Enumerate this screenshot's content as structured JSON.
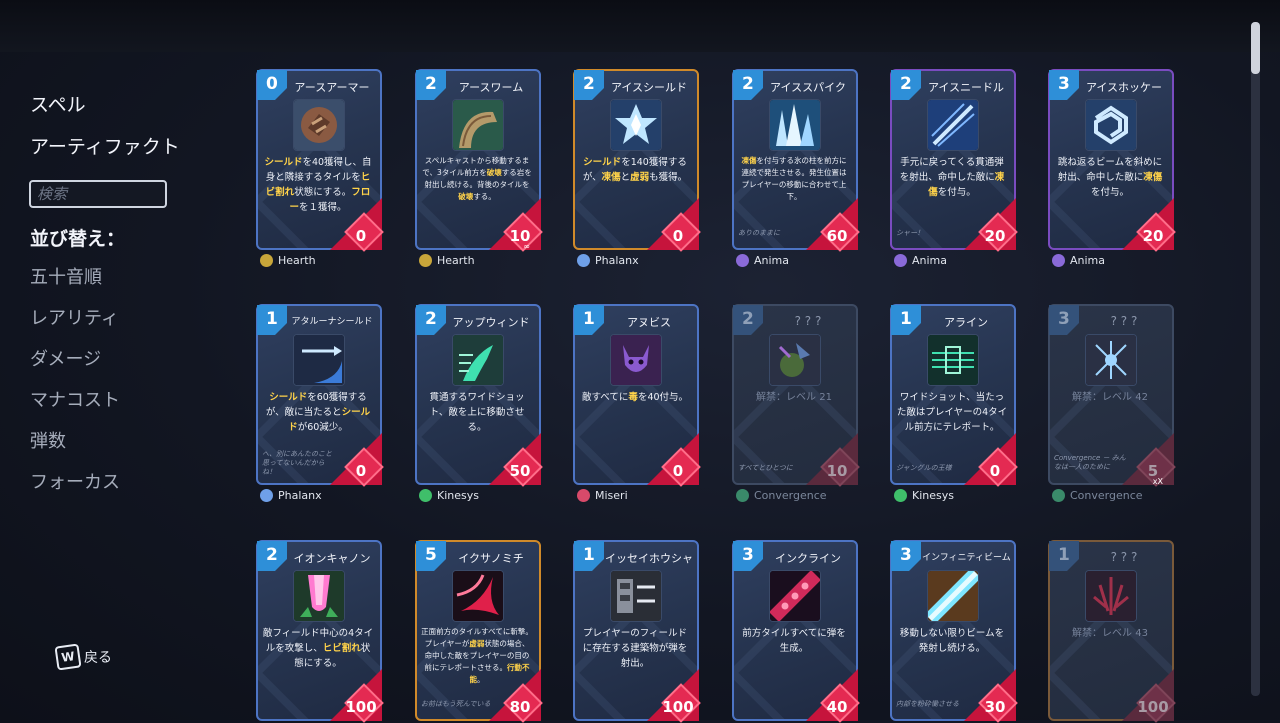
{
  "sidebar": {
    "spells": "スペル",
    "artifacts": "アーティファクト",
    "search_placeholder": "検索",
    "sort_label": "並び替え：",
    "sort_options": [
      "五十音順",
      "レアリティ",
      "ダメージ",
      "マナコスト",
      "弾数",
      "フォーカス"
    ],
    "back_key": "W",
    "back_label": "戻る"
  },
  "cards": [
    {
      "cost": "0",
      "name": "アースアーマー",
      "desc": "シールドを40獲得し、自身と隣接するタイルをヒビ割れ状態にする。フローを１獲得。",
      "flavor": "",
      "damage": "0",
      "school": "Hearth"
    },
    {
      "cost": "2",
      "name": "アースワーム",
      "desc": "スペルキャストから移動するまで、3タイル前方を破壊する岩を射出し続ける。背後のタイルを破壊する。",
      "flavor": "",
      "damage": "10",
      "damage_sub": "∞",
      "school": "Hearth"
    },
    {
      "cost": "2",
      "name": "アイスシールド",
      "desc": "シールドを140獲得するが、凍傷と虚弱も獲得。",
      "flavor": "",
      "damage": "0",
      "school": "Phalanx"
    },
    {
      "cost": "2",
      "name": "アイススパイク",
      "desc": "凍傷を付与する氷の柱を前方に連続で発生させる。発生位置はプレイヤーの移動に合わせて上下。",
      "flavor": "ありのままに",
      "damage": "60",
      "school": "Anima"
    },
    {
      "cost": "2",
      "name": "アイスニードル",
      "desc": "手元に戻ってくる貫通弾を射出、命中した敵に凍傷を付与。",
      "flavor": "シャー！",
      "damage": "20",
      "school": "Anima"
    },
    {
      "cost": "3",
      "name": "アイスホッケー",
      "desc": "跳ね返るビームを斜めに射出、命中した敵に凍傷を付与。",
      "flavor": "",
      "damage": "20",
      "school": "Anima"
    },
    {
      "cost": "1",
      "name": "アタルーナシールド",
      "desc": "シールドを60獲得するが、敵に当たるとシールドが60減少。",
      "flavor": "へ、別にあんたのこと思ってないんだからね！",
      "damage": "0",
      "school": "Phalanx"
    },
    {
      "cost": "2",
      "name": "アップウィンド",
      "desc": "貫通するワイドショット、敵を上に移動させる。",
      "flavor": "",
      "damage": "50",
      "school": "Kinesys"
    },
    {
      "cost": "1",
      "name": "アヌビス",
      "desc": "敵すべてに毒を40付与。",
      "flavor": "",
      "damage": "0",
      "school": "Miseri"
    },
    {
      "cost": "2",
      "name": "? ? ?",
      "desc": "解禁：レベル 21",
      "flavor": "すべてとひとつに",
      "damage": "10",
      "school": "Convergence"
    },
    {
      "cost": "1",
      "name": "アライン",
      "desc": "ワイドショット、当たった敵はプレイヤーの4タイル前方にテレポート。",
      "flavor": "ジャングルの王様",
      "damage": "0",
      "school": "Kinesys"
    },
    {
      "cost": "3",
      "name": "? ? ?",
      "desc": "解禁：レベル 42",
      "flavor": "Convergence － みんなは一人のために",
      "damage": "5",
      "damage_sub": "xX",
      "school": "Convergence"
    },
    {
      "cost": "2",
      "name": "イオンキャノン",
      "desc": "敵フィールド中心の4タイルを攻撃し、ヒビ割れ状態にする。",
      "flavor": "",
      "damage": "100",
      "school": ""
    },
    {
      "cost": "5",
      "name": "イクサノミチ",
      "desc": "正面前方のタイルすべてに斬撃。プレイヤーが虚弱状態の場合、命中した敵をプレイヤーの目の前にテレポートさせる。行動不能。",
      "flavor": "お前はもう死んでいる",
      "damage": "80",
      "school": ""
    },
    {
      "cost": "1",
      "name": "イッセイホウシャ",
      "desc": "プレイヤーのフィールドに存在する建築物が弾を射出。",
      "flavor": "",
      "damage": "100",
      "school": ""
    },
    {
      "cost": "3",
      "name": "インクライン",
      "desc": "前方タイルすべてに弾を生成。",
      "flavor": "",
      "damage": "40",
      "school": ""
    },
    {
      "cost": "3",
      "name": "インフィニティビーム",
      "desc": "移動しない限りビームを発射し続ける。",
      "flavor": "内部を粉砕慟させる",
      "damage": "30",
      "school": ""
    },
    {
      "cost": "1",
      "name": "? ? ?",
      "desc": "解禁：レベル 43",
      "flavor": "",
      "damage": "100",
      "school": ""
    }
  ],
  "colors": {
    "mana": "#2e8fd8",
    "damage": "#e42a52",
    "highlight": "#ffd34a",
    "background": "#121622"
  }
}
